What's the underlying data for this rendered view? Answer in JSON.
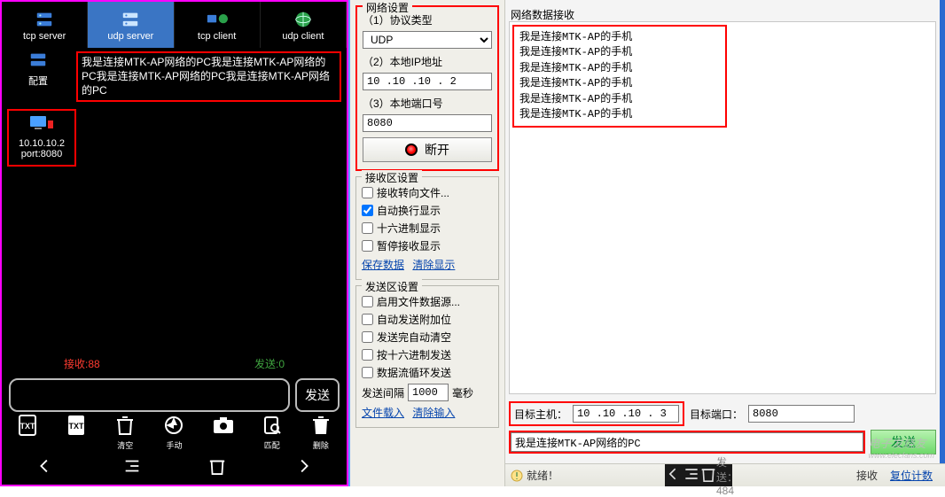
{
  "left": {
    "tabs": [
      {
        "label": "tcp server"
      },
      {
        "label": "udp server"
      },
      {
        "label": "tcp client"
      },
      {
        "label": "udp client"
      }
    ],
    "selected_tab": 1,
    "config_label": "配置",
    "message_box": "我是连接MTK-AP网络的PC我是连接MTK-AP网络的PC我是连接MTK-AP网络的PC我是连接MTK-AP网络的PC",
    "conn": {
      "ip": "10.10.10.2",
      "port": "port:8080"
    },
    "rx_label": "接收:88",
    "tx_label": "发送:0",
    "send_label": "发送",
    "actions": [
      {
        "label": "TXT"
      },
      {
        "label": "TXT"
      },
      {
        "label": "清空"
      },
      {
        "label": "手动"
      },
      {
        "label": ""
      },
      {
        "label": "匹配"
      },
      {
        "label": "删除"
      }
    ]
  },
  "right": {
    "net_settings_title": "网络设置",
    "net_recv_title": "网络数据接收",
    "p1_label": "（1）协议类型",
    "protocol": "UDP",
    "p2_label": "（2）本地IP地址",
    "local_ip": "10 .10 .10 . 2",
    "p3_label": "（3）本地端口号",
    "local_port": "8080",
    "disconnect_label": "断开",
    "recv_settings_title": "接收区设置",
    "recv_checks": [
      {
        "label": "接收转向文件...",
        "checked": false
      },
      {
        "label": "自动换行显示",
        "checked": true
      },
      {
        "label": "十六进制显示",
        "checked": false
      },
      {
        "label": "暂停接收显示",
        "checked": false
      }
    ],
    "save_data": "保存数据",
    "clear_display": "清除显示",
    "send_settings_title": "发送区设置",
    "send_checks": [
      {
        "label": "启用文件数据源...",
        "checked": false
      },
      {
        "label": "自动发送附加位",
        "checked": false
      },
      {
        "label": "发送完自动清空",
        "checked": false
      },
      {
        "label": "按十六进制发送",
        "checked": false
      },
      {
        "label": "数据流循环发送",
        "checked": false
      }
    ],
    "interval_prefix": "发送间隔",
    "interval_value": "1000",
    "interval_suffix": "毫秒",
    "file_load": "文件载入",
    "clear_input": "清除输入",
    "recv_lines": [
      "我是连接MTK-AP的手机",
      "我是连接MTK-AP的手机",
      "我是连接MTK-AP的手机",
      "我是连接MTK-AP的手机",
      "我是连接MTK-AP的手机",
      "我是连接MTK-AP的手机"
    ],
    "target_host_label": "目标主机：",
    "target_host": "10 .10 .10 . 3",
    "target_port_label": "目标端口：",
    "target_port": "8080",
    "send_input": "我是连接MTK-AP网络的PC",
    "send_btn": "发送",
    "status_ready": "就绪！",
    "status_send_label": "发送：",
    "status_send_val": "484",
    "status_recv_label": "接收",
    "status_reset": "复位计数",
    "watermark": "电子发烧友",
    "watermark_sub": "www.elecfans.com"
  }
}
